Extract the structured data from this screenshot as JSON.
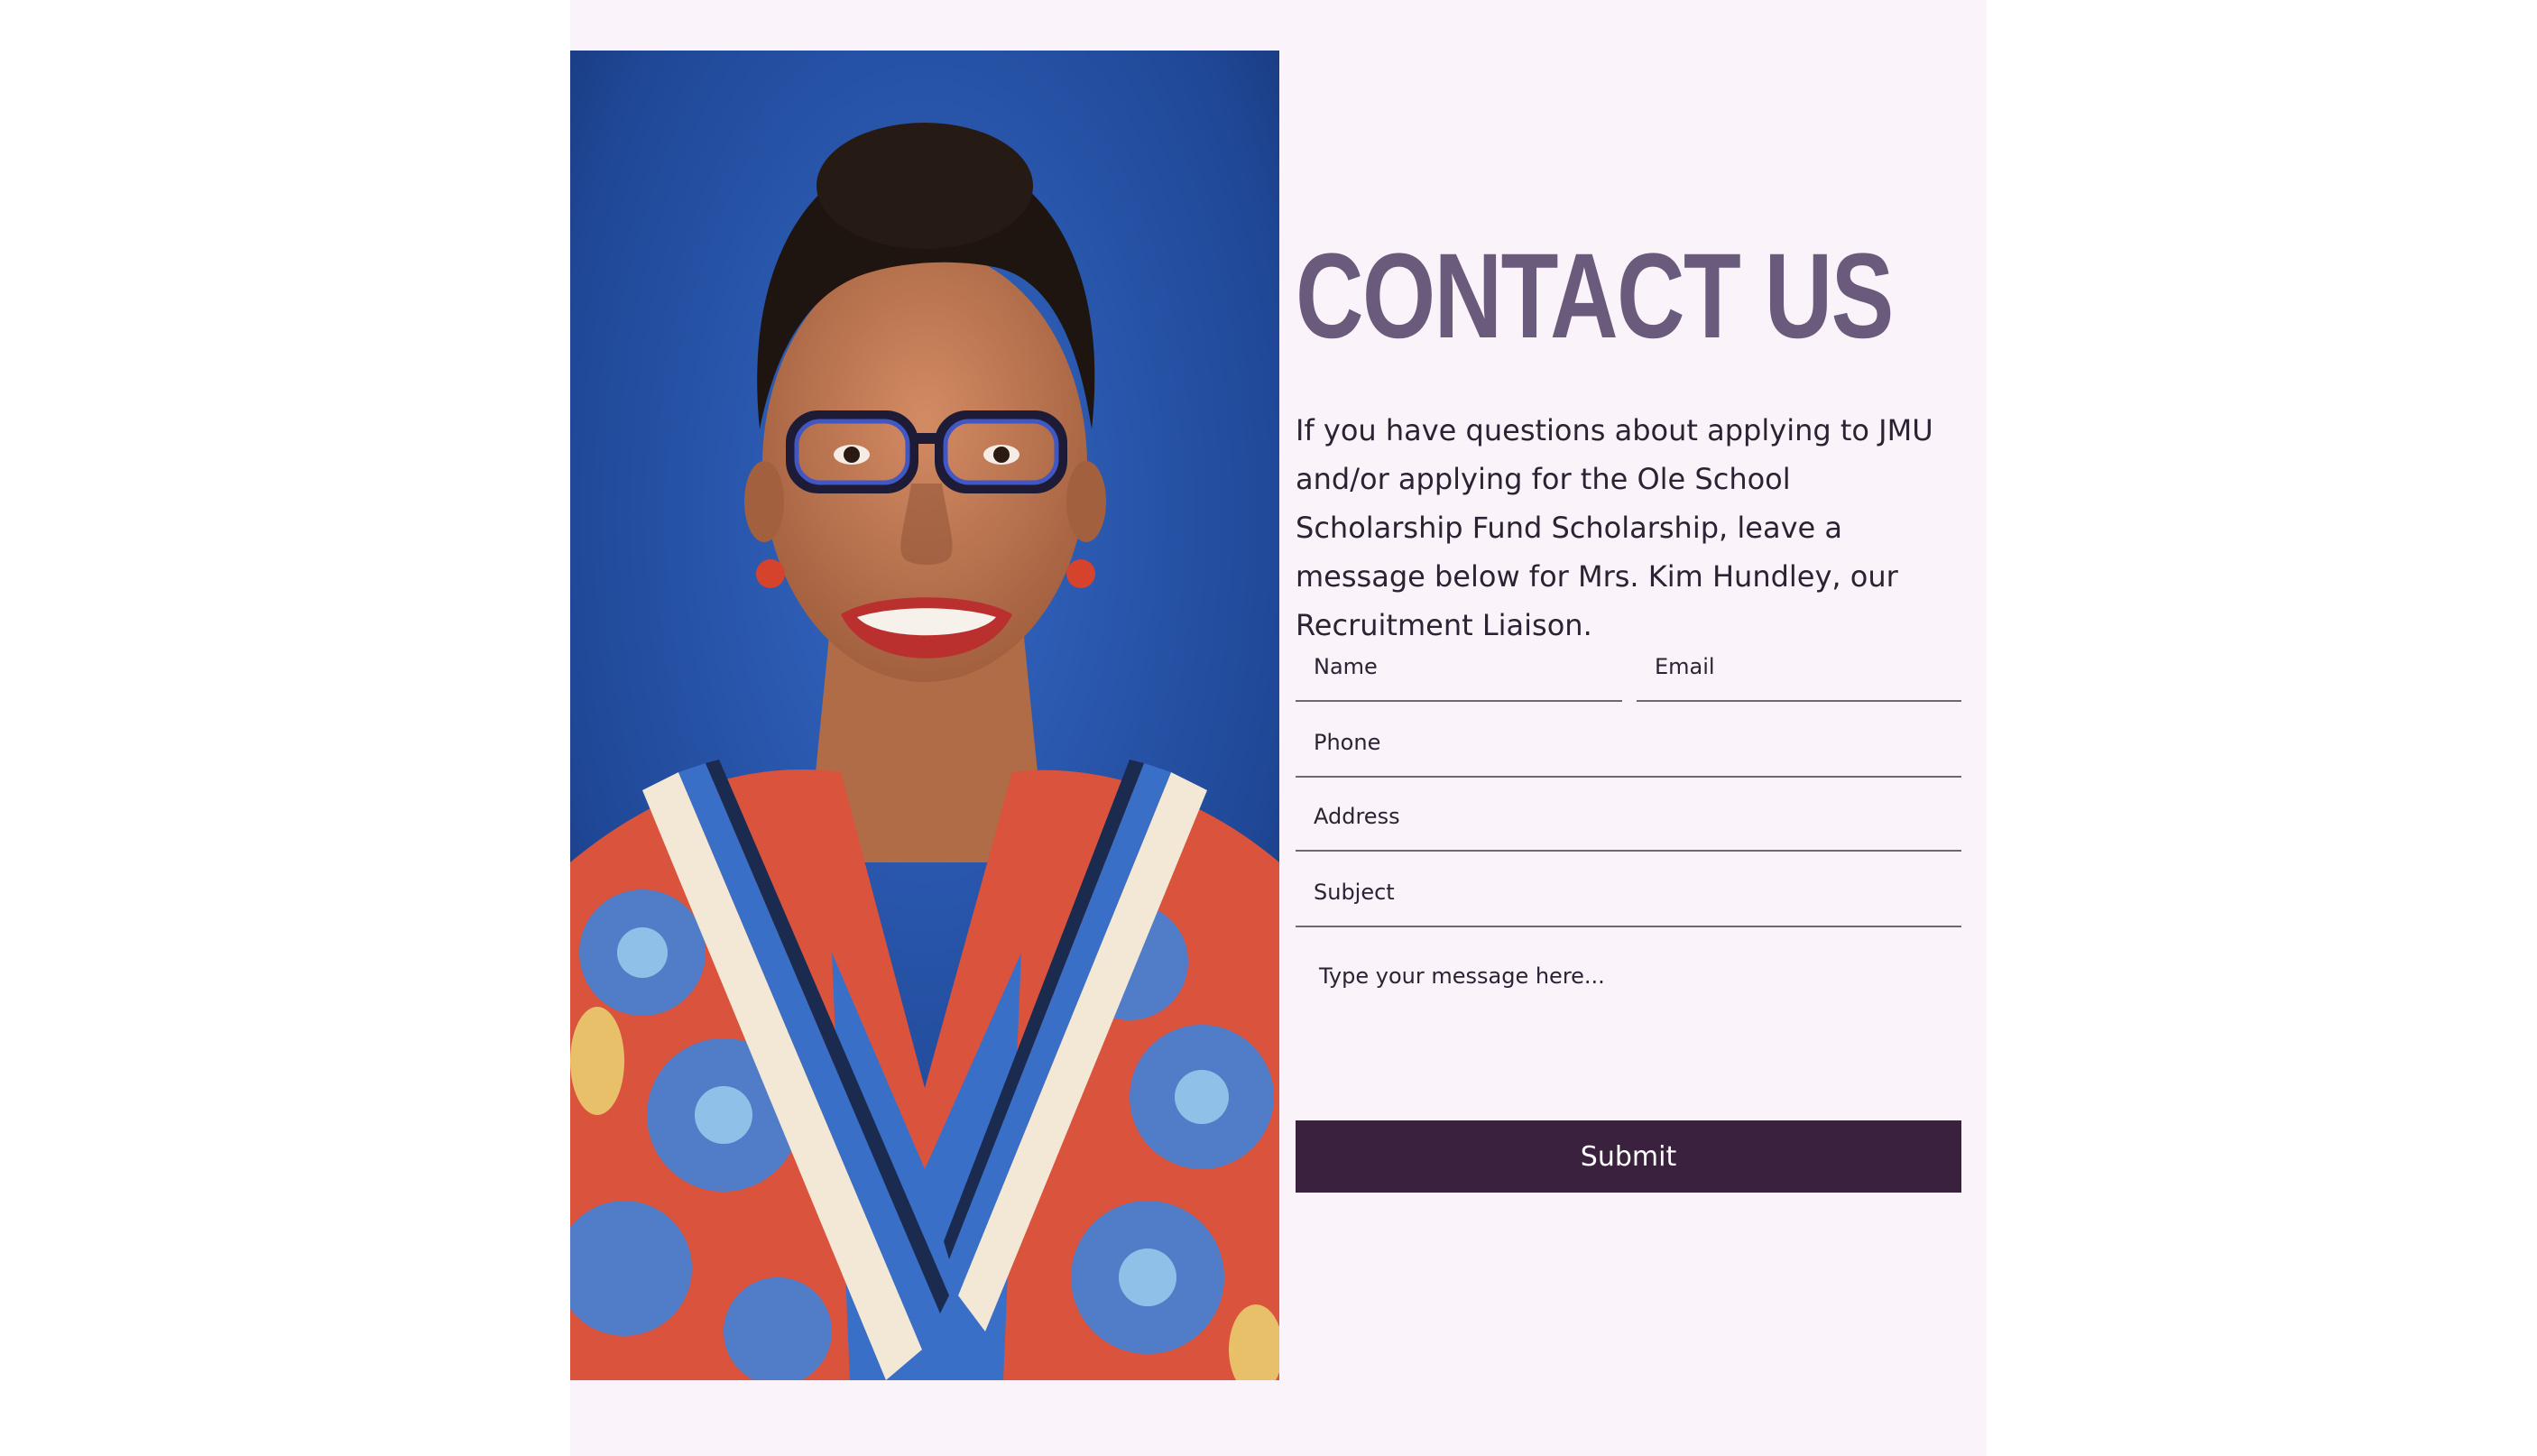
{
  "contact": {
    "heading": "CONTACT US",
    "intro": "If you have questions about applying to JMU and/or applying for the Ole School Scholarship Fund Scholarship, leave a message below for Mrs. Kim Hundley, our Recruitment Liaison."
  },
  "form": {
    "name_placeholder": "Name",
    "email_placeholder": "Email",
    "phone_placeholder": "Phone",
    "address_placeholder": "Address",
    "subject_placeholder": "Subject",
    "message_placeholder": "Type your message here...",
    "submit_label": "Submit"
  },
  "colors": {
    "panel_background": "#faf3fa",
    "heading": "#6a5a7c",
    "button": "#3a213d",
    "photo_background": "#1f4796"
  }
}
